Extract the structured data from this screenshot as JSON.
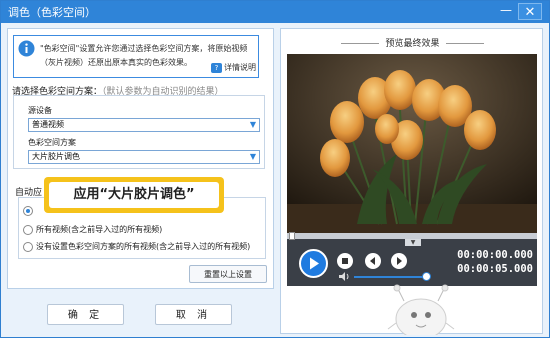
{
  "window": {
    "title": "调色（色彩空间）",
    "minimize_glyph": "—",
    "close_glyph": "✕"
  },
  "info": {
    "text": "\"色彩空间\"设置允许您通过选择色彩空间方案，将原始视频（灰片视频）还原出原本真实的色彩效果。",
    "help_link": "详情说明",
    "icon": "info-icon"
  },
  "scheme_section": {
    "label": "请选择色彩空间方案：",
    "hint": "（默认参数为自动识别的结果）",
    "source_device_label": "源设备",
    "source_device_value": "普通视频",
    "color_scheme_label": "色彩空间方案",
    "color_scheme_value": "大片胶片调色"
  },
  "auto_section": {
    "label": "自动应",
    "options": [
      {
        "label": "",
        "checked": true
      },
      {
        "label": "所有视频(含之前导入过的所有视频)",
        "checked": false
      },
      {
        "label": "没有设置色彩空间方案的所有视频(含之前导入过的所有视频)",
        "checked": false
      }
    ]
  },
  "reset_button": "重置以上设置",
  "callout": "应用“大片胶片调色”",
  "ok_button": "确 定",
  "cancel_button": "取 消",
  "preview": {
    "title": "预览最终效果",
    "current_time": "00:00:00.000",
    "total_time": "00:00:05.000",
    "volume_fraction": 0.95,
    "timeline_fraction": 0.0
  },
  "colors": {
    "titlebar": "#2f84d8",
    "accent": "#2f84d8",
    "callout": "#f5c21b"
  }
}
